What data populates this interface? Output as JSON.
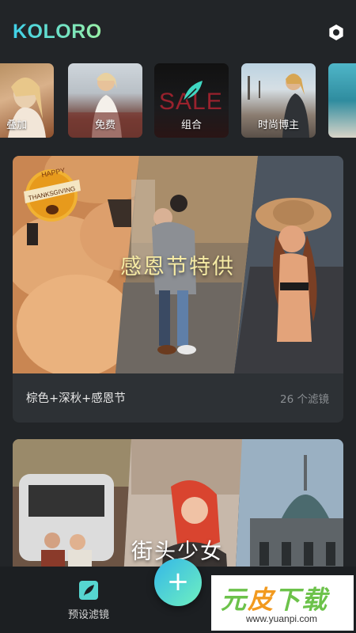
{
  "app": {
    "title": "KOLORO"
  },
  "colors": {
    "background": "#222528",
    "accent_start": "#3fd0e8",
    "accent_end": "#9af0a6",
    "card_bg": "#2d3135"
  },
  "icons": {
    "settings": "gear-icon",
    "presets": "feather-icon",
    "add": "plus-icon"
  },
  "filter_tiles": [
    {
      "label": "叠加"
    },
    {
      "label": "免费"
    },
    {
      "label": "组合",
      "sign_text": "SALE"
    },
    {
      "label": "时尚博主"
    },
    {
      "label": ""
    }
  ],
  "collections": [
    {
      "overlay_title": "感恩节特供",
      "badge_top": "HAPPY",
      "badge_bottom": "THANKSGIVING",
      "title": "棕色+深秋+感恩节",
      "count": "26 个滤镜"
    },
    {
      "overlay_title": "街头少女"
    }
  ],
  "bottom_nav": {
    "presets_label": "预设滤镜",
    "add_symbol": "+"
  },
  "watermark": {
    "brand_left": "元",
    "brand_mid": "皮",
    "brand_right": "下载",
    "url": "www.yuanpi.com"
  }
}
